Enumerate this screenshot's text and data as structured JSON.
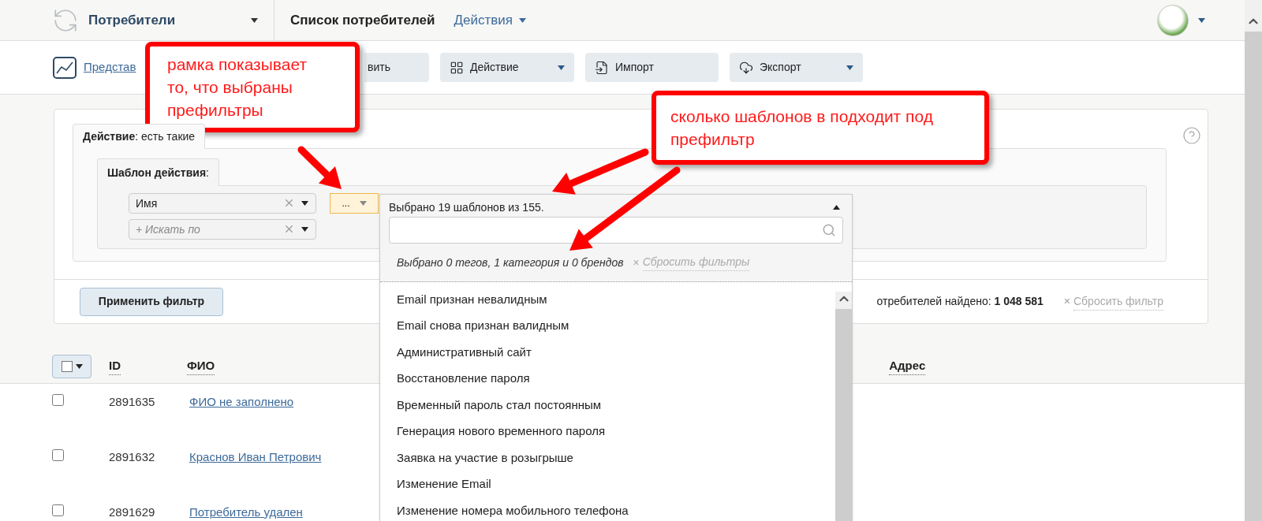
{
  "header": {
    "module": "Потребители",
    "title": "Список потребителей",
    "actions_menu": "Действия"
  },
  "toolbar": {
    "view_link": "Представ",
    "buttons": [
      {
        "label": "вить",
        "kind": "plain"
      },
      {
        "label": "Действие",
        "kind": "menu"
      },
      {
        "label": "Импорт",
        "kind": "plain"
      },
      {
        "label": "Экспорт",
        "kind": "menu"
      }
    ]
  },
  "filter": {
    "outer_tab": "**Действие**: есть такие",
    "inner_tab": "**Шаблон действия**:",
    "fields": [
      {
        "value": "Имя"
      },
      {
        "placeholder": "+ Искать по"
      }
    ],
    "prefilter_button": {
      "label": "...",
      "active": true
    },
    "apply_button": "Применить фильтр",
    "found_text": "отребителей найдено: **1 048 581**",
    "reset_icon": "×",
    "reset": "Сбросить фильтр"
  },
  "dropdown": {
    "summary": "Выбрано 19 шаблонов из 155.",
    "selection_info": "Выбрано 0 тегов, 1 категория и 0 брендов",
    "reset_icon": "×",
    "reset_filters": "Сбросить фильтры",
    "items": [
      "Email признан невалидным",
      "Email снова признан валидным",
      "Административный сайт",
      "Восстановление пароля",
      "Временный пароль стал постоянным",
      "Генерация нового временного пароля",
      "Заявка на участие в розыгрыше",
      "Изменение Email",
      "Изменение номера мобильного телефона"
    ]
  },
  "table": {
    "select_all": {
      "checked": false
    },
    "columns": [
      "ID",
      "ФИО",
      "Адрес"
    ],
    "rows": [
      {
        "id": "2891635",
        "name": "ФИО не заполнено",
        "checked": false
      },
      {
        "id": "2891632",
        "name": "Краснов Иван Петрович",
        "checked": false
      },
      {
        "id": "2891629",
        "name": "Потребитель удален",
        "checked": false
      }
    ]
  },
  "annotations": [
    {
      "text": "рамка показывает то, что выбраны префильтры"
    },
    {
      "text": "сколько шаблонов в подходит под префильтр"
    }
  ]
}
